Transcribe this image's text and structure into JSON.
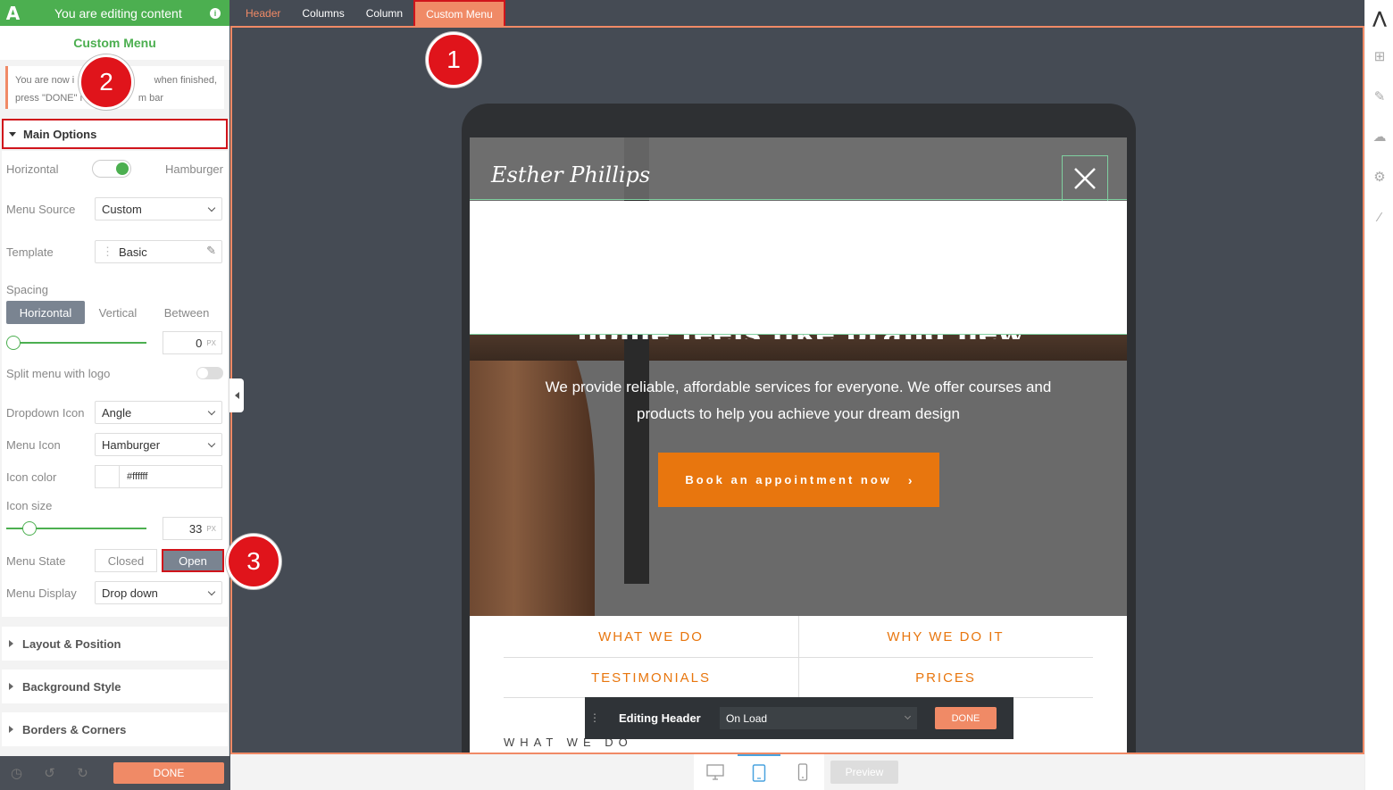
{
  "topbar": {
    "logo": "A",
    "editing_text": "You are editing content",
    "info": "i"
  },
  "panel": {
    "title": "Custom Menu",
    "note": {
      "l1a": "You are now i",
      "l1b": "when finished,",
      "l2a": "press \"DONE\" i",
      "l2b": "m bar"
    },
    "main_options_label": "Main Options",
    "horizontal": {
      "label": "Horizontal",
      "right_label": "Hamburger"
    },
    "menu_source": {
      "label": "Menu Source",
      "value": "Custom"
    },
    "template": {
      "label": "Template",
      "value": "Basic"
    },
    "spacing": {
      "label": "Spacing",
      "tabs": [
        "Horizontal",
        "Vertical",
        "Between"
      ],
      "value": "0",
      "unit": "PX"
    },
    "split_menu": {
      "label": "Split menu with logo"
    },
    "dropdown_icon": {
      "label": "Dropdown Icon",
      "value": "Angle"
    },
    "menu_icon": {
      "label": "Menu Icon",
      "value": "Hamburger"
    },
    "icon_color": {
      "label": "Icon color",
      "value": "#ffffff"
    },
    "icon_size": {
      "label": "Icon size",
      "value": "33",
      "unit": "PX"
    },
    "menu_state": {
      "label": "Menu State",
      "closed": "Closed",
      "open": "Open"
    },
    "menu_display": {
      "label": "Menu Display",
      "value": "Drop down"
    },
    "sections": [
      "Layout & Position",
      "Background Style",
      "Borders & Corners"
    ],
    "done": "DONE"
  },
  "breadcrumb": [
    "Header",
    "Columns",
    "Column",
    "Custom Menu"
  ],
  "site": {
    "logo": "Esther Phillips",
    "headline": "home feels like brand new",
    "lead": "We provide reliable, affordable services for everyone. We offer courses and products to help you achieve your dream design",
    "cta": "Book an appointment now",
    "cta_arrow": "›",
    "nav": [
      "WHAT WE DO",
      "WHY WE DO IT",
      "TESTIMONIALS",
      "PRICES"
    ],
    "section_label": "WHAT WE DO"
  },
  "edit_bar": {
    "title": "Editing Header",
    "select": "On Load",
    "done": "DONE"
  },
  "device_bar": {
    "preview": "Preview"
  },
  "markers": [
    "1",
    "2",
    "3"
  ],
  "colors": {
    "accent": "#f08a66",
    "green": "#4caf50",
    "highlight": "#d0141b",
    "orange": "#e8760e"
  }
}
